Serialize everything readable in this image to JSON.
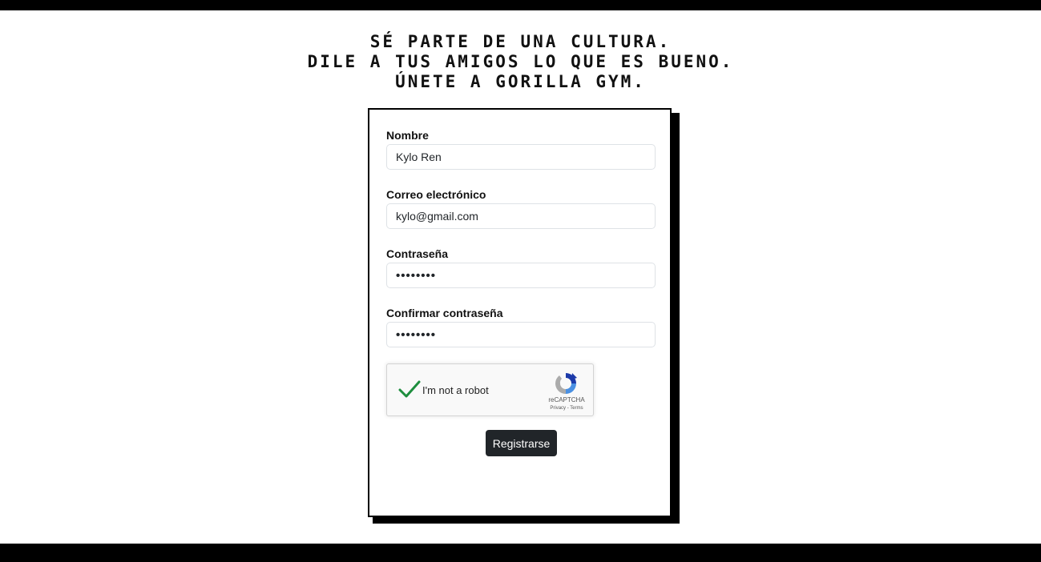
{
  "headline": {
    "line1": "SÉ PARTE DE UNA CULTURA.",
    "line2": "DILE A TUS AMIGOS LO QUE ES BUENO.",
    "line3": "ÚNETE A GORILLA GYM."
  },
  "form": {
    "name_label": "Nombre",
    "name_value": "Kylo Ren",
    "email_label": "Correo electrónico",
    "email_value": "kylo@gmail.com",
    "password_label": "Contraseña",
    "password_value": "••••••••",
    "confirm_label": "Confirmar contraseña",
    "confirm_value": "••••••••",
    "submit_label": "Registrarse"
  },
  "captcha": {
    "label": "I'm not a robot",
    "brand": "reCAPTCHA",
    "links": "Privacy - Terms",
    "checked_icon": "checkmark-icon",
    "logo_icon": "recaptcha-logo-icon",
    "check_color": "#1e8e3e"
  },
  "footer": {
    "text": ""
  },
  "colors": {
    "background": "#ffffff",
    "bars": "#000000",
    "button": "#212529"
  }
}
